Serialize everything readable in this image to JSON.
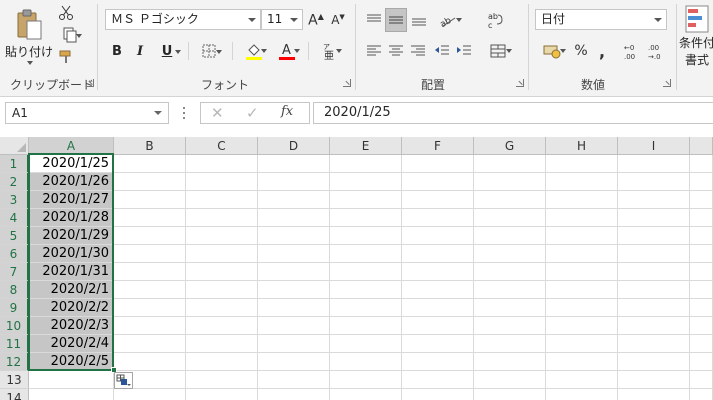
{
  "ribbon": {
    "clipboard": {
      "paste_label": "貼り付け",
      "group_label": "クリップボード"
    },
    "font": {
      "font_name": "ＭＳ Ｐゴシック",
      "font_size": "11",
      "bold": "B",
      "italic": "I",
      "underline": "U",
      "group_label": "フォント"
    },
    "alignment": {
      "group_label": "配置"
    },
    "number": {
      "format": "日付",
      "percent": "%",
      "comma": ",",
      "group_label": "数値"
    },
    "styles": {
      "cond_format_line1": "条件付",
      "cond_format_line2": "書式"
    }
  },
  "formula_bar": {
    "name_box": "A1",
    "formula": "2020/1/25",
    "fx": "fx"
  },
  "sheet": {
    "columns": [
      "A",
      "B",
      "C",
      "D",
      "E",
      "F",
      "G",
      "H",
      "I"
    ],
    "rows": [
      "1",
      "2",
      "3",
      "4",
      "5",
      "6",
      "7",
      "8",
      "9",
      "10",
      "11",
      "12",
      "13",
      "14"
    ],
    "column_a": [
      "2020/1/25",
      "2020/1/26",
      "2020/1/27",
      "2020/1/28",
      "2020/1/29",
      "2020/1/30",
      "2020/1/31",
      "2020/2/1",
      "2020/2/2",
      "2020/2/3",
      "2020/2/4",
      "2020/2/5"
    ]
  },
  "colors": {
    "accent": "#217346",
    "selection_fill": "#c6c6c6",
    "font_color_bar": "#ff0000",
    "fill_color_bar": "#ffff00"
  }
}
